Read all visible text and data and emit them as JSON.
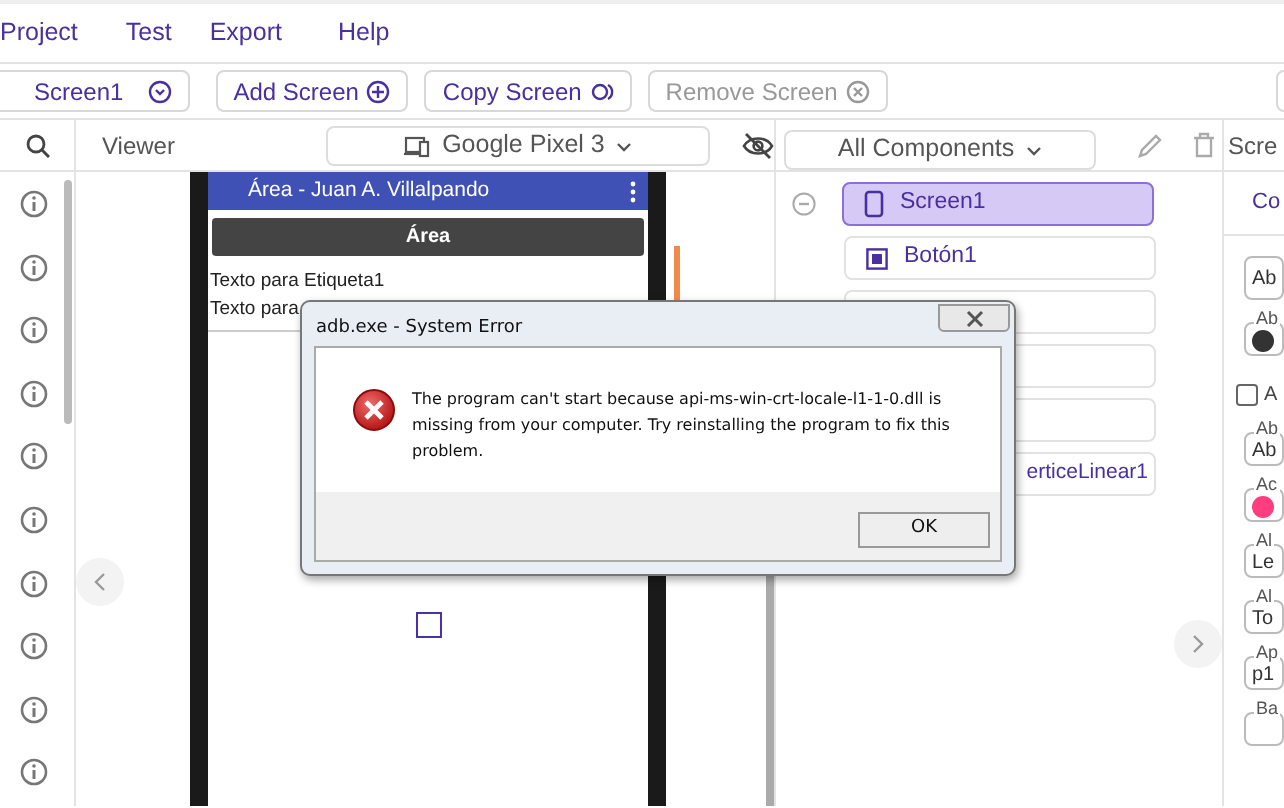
{
  "menu": [
    {
      "label": "Project"
    },
    {
      "label": "Test"
    },
    {
      "label": "Export"
    },
    {
      "label": "Help"
    }
  ],
  "toolbar": {
    "screen_selector": "Screen1",
    "buttons": [
      {
        "label": "Add Screen",
        "kind": "add",
        "disabled": false
      },
      {
        "label": "Copy Screen",
        "kind": "copy",
        "disabled": false
      },
      {
        "label": "Remove Screen",
        "kind": "remove",
        "disabled": true
      }
    ]
  },
  "viewer": {
    "title": "Viewer",
    "device": "Google Pixel 3",
    "app": {
      "title": "Área - Juan A. Villalpando",
      "button": "Área",
      "labels": [
        "Texto para Etiqueta1",
        "Texto para"
      ]
    }
  },
  "components": {
    "filter": "All Components",
    "tree": [
      {
        "label": "Screen1",
        "selected": true,
        "expanded": true,
        "children": [
          {
            "label": "Botón1",
            "selected": false
          },
          {
            "selected": false
          },
          {
            "selected": false
          },
          {
            "selected": false
          },
          {
            "label": "erticeLinear1",
            "selected": false
          }
        ]
      }
    ]
  },
  "properties": {
    "title": "Scre",
    "tab": "Co",
    "fields": [
      {
        "kind": "select",
        "value": "Ab"
      },
      {
        "kind": "color",
        "label": "Ab",
        "color": "#333333"
      },
      {
        "kind": "checkbox",
        "label": "A",
        "checked": false
      },
      {
        "kind": "text",
        "label": "Ab",
        "value": "Ab"
      },
      {
        "kind": "color",
        "label": "Ac",
        "color": "#ff3d7f"
      },
      {
        "kind": "text",
        "label": "Al",
        "value": "Le"
      },
      {
        "kind": "text",
        "label": "Al",
        "value": "To"
      },
      {
        "kind": "text",
        "label": "Ap",
        "value": "p1"
      },
      {
        "kind": "text",
        "label": "Ba"
      }
    ]
  },
  "dialog": {
    "title": "adb.exe - System Error",
    "message": "The program can't start because api-ms-win-crt-locale-l1-1-0.dll is missing from your computer. Try reinstalling the program to fix this problem.",
    "buttons": [
      "OK"
    ]
  }
}
